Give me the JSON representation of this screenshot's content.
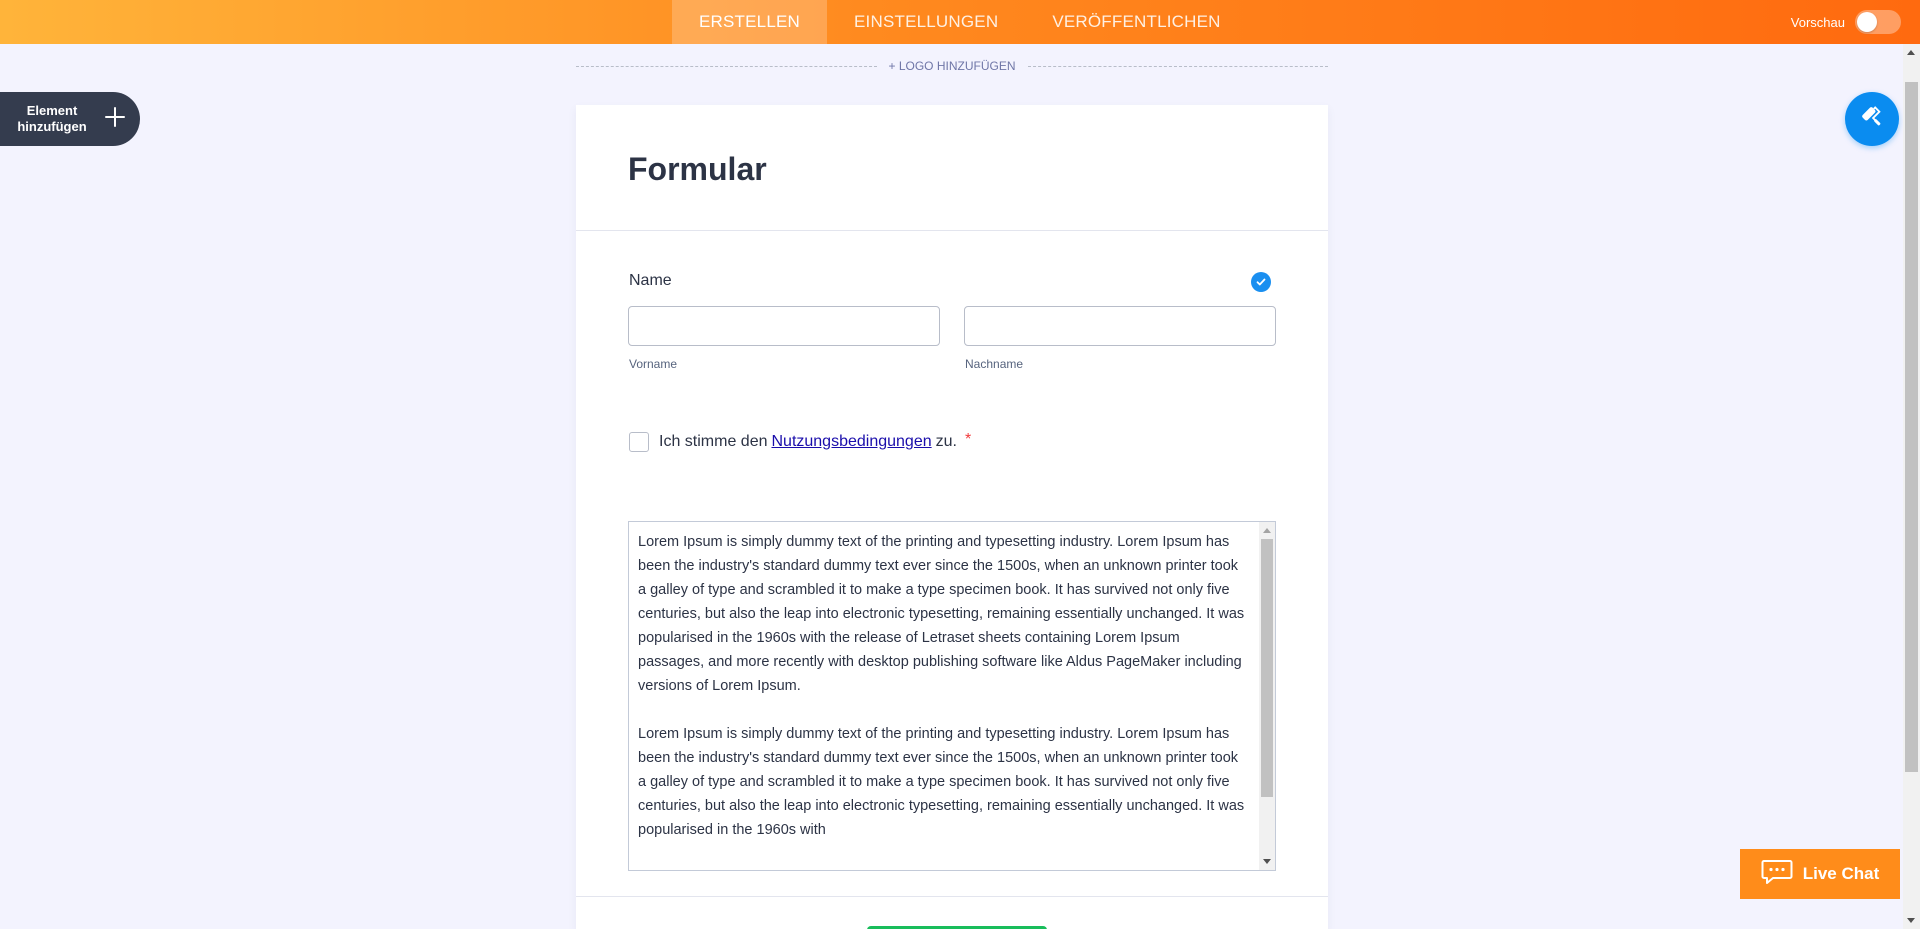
{
  "topbar": {
    "tabs": [
      {
        "label": "ERSTELLEN",
        "active": true
      },
      {
        "label": "EINSTELLUNGEN",
        "active": false
      },
      {
        "label": "VERÖFFENTLICHEN",
        "active": false
      }
    ],
    "preview_label": "Vorschau",
    "preview_on": false
  },
  "logo": {
    "label": "+ LOGO HINZUFÜGEN"
  },
  "add_element": {
    "label": "Element\nhinzufügen",
    "icon": "plus-icon"
  },
  "designer": {
    "icon": "paint-roller-icon"
  },
  "form": {
    "title": "Formular",
    "name_field": {
      "label": "Name",
      "first_value": "",
      "last_value": "",
      "first_sublabel": "Vorname",
      "last_sublabel": "Nachname"
    },
    "terms": {
      "prefix": "Ich stimme den",
      "link": "Nutzungsbedingungen",
      "suffix": "zu.",
      "required_mark": "*",
      "checked": false
    },
    "terms_text": "Lorem Ipsum is simply dummy text of the printing and typesetting industry. Lorem Ipsum has been the industry's standard dummy text ever since the 1500s, when an unknown printer took a galley of type and scrambled it to make a type specimen book. It has survived not only five centuries, but also the leap into electronic typesetting, remaining essentially unchanged. It was popularised in the 1960s with the release of Letraset sheets containing Lorem Ipsum passages, and more recently with desktop publishing software like Aldus PageMaker including versions of Lorem Ipsum.\n\nLorem Ipsum is simply dummy text of the printing and typesetting industry. Lorem Ipsum has been the industry's standard dummy text ever since the 1500s, when an unknown printer took a galley of type and scrambled it to make a type specimen book. It has survived not only five centuries, but also the leap into electronic typesetting, remaining essentially unchanged. It was popularised in the 1960s with"
  },
  "live_chat": {
    "label": "Live Chat",
    "icon": "chat-bubble-icon"
  },
  "colors": {
    "accent_orange": "#ff8a1f",
    "brand_blue": "#0a8cf0",
    "dark_button": "#343c4e",
    "submit_green": "#18bd5b"
  }
}
